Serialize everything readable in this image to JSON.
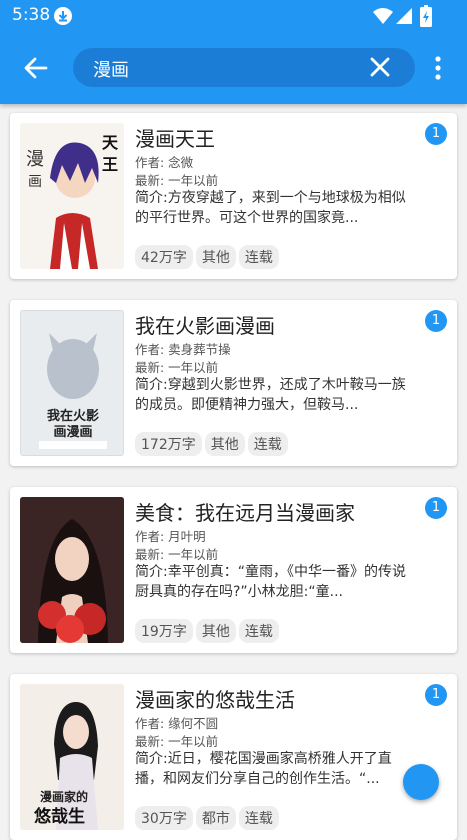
{
  "status_bar": {
    "time": "5:38"
  },
  "search": {
    "query": "漫画"
  },
  "colors": {
    "primary": "#2196f3",
    "badge": "#2196f3"
  },
  "results": [
    {
      "title": "漫画天王",
      "author": "作者: 念微",
      "updated": "最新: 一年以前",
      "intro": "简介:方夜穿越了，来到一个与地球极为相似的平行世界。可这个世界的国家竟...",
      "tags": [
        "42万字",
        "其他",
        "连载"
      ],
      "badge": "1",
      "cover": {
        "line1": "漫",
        "line2": "画",
        "line3": "天",
        "line4": "王"
      }
    },
    {
      "title": "我在火影画漫画",
      "author": "作者: 卖身葬节操",
      "updated": "最新: 一年以前",
      "intro": "简介:穿越到火影世界，还成了木叶鞍马一族的成员。即便精神力强大，但鞍马...",
      "tags": [
        "172万字",
        "其他",
        "连载"
      ],
      "badge": "1",
      "cover": {
        "line1": "我在火影",
        "line2": "画漫画"
      }
    },
    {
      "title": "美食：我在远月当漫画家",
      "author": "作者: 月叶明",
      "updated": "最新: 一年以前",
      "intro": "简介:幸平创真：“童雨，《中华一番》的传说厨具真的存在吗?”小林龙胆:“童...",
      "tags": [
        "19万字",
        "其他",
        "连载"
      ],
      "badge": "1"
    },
    {
      "title": "漫画家的悠哉生活",
      "author": "作者: 缘何不圆",
      "updated": "最新: 一年以前",
      "intro": "简介:近日，樱花国漫画家高桥雅人开了直播，和网友们分享自己的创作生活。“...",
      "tags": [
        "30万字",
        "都市",
        "连载"
      ],
      "badge": "1",
      "cover": {
        "line1": "漫画家的",
        "line2": "悠哉生"
      }
    }
  ]
}
